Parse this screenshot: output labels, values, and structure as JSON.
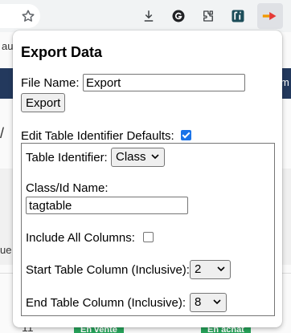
{
  "browser": {
    "toolbar_icons": [
      "star-icon",
      "download-icon",
      "g-extension-icon",
      "puzzle-icon",
      "pin-extension-icon",
      "export-extension-icon"
    ]
  },
  "background": {
    "frag_au": "au",
    "frag_m": "m",
    "frag_slash": "/",
    "frag_ue": "ue",
    "row_number": "11",
    "tag_sale": "En vente",
    "tag_buy": "En achat",
    "colors": {
      "navbar": "#23395d",
      "tag": "#27a35a"
    }
  },
  "popup": {
    "title": "Export Data",
    "file_name_label": "File Name:",
    "file_name_value": "Export",
    "export_button": "Export",
    "edit_defaults_label": "Edit Table Identifier Defaults:",
    "edit_defaults_checked": true,
    "table_identifier_label": "Table Identifier:",
    "table_identifier_value": "Class",
    "class_id_label": "Class/Id Name:",
    "class_id_value": "tagtable",
    "include_all_label": "Include All Columns:",
    "include_all_checked": false,
    "start_col_label": "Start Table Column (Inclusive):",
    "start_col_value": "2",
    "end_col_label": "End Table Column (Inclusive):",
    "end_col_value": "8",
    "colors": {
      "checkbox_accent": "#1a73e8"
    }
  }
}
